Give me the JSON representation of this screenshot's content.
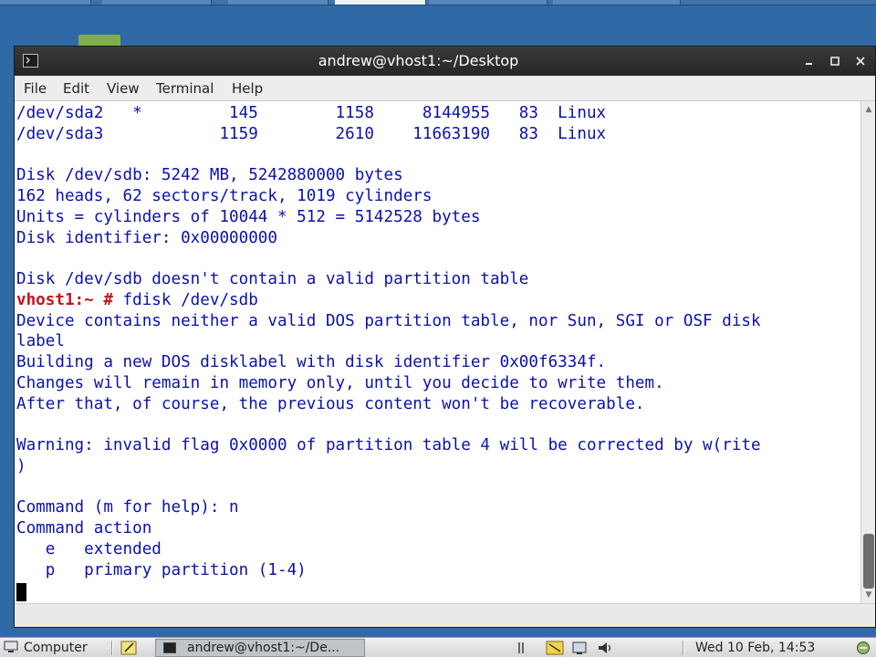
{
  "window": {
    "title": "andrew@vhost1:~/Desktop",
    "icon": "terminal-icon",
    "buttons": {
      "minimize": "minimize-icon",
      "maximize": "maximize-icon",
      "close": "close-icon"
    }
  },
  "menubar": {
    "items": [
      {
        "label": "File"
      },
      {
        "label": "Edit"
      },
      {
        "label": "View"
      },
      {
        "label": "Terminal"
      },
      {
        "label": "Help"
      }
    ]
  },
  "terminal": {
    "lines": [
      {
        "text": "/dev/sda2   *         145        1158     8144955   83  Linux"
      },
      {
        "text": "/dev/sda3            1159        2610    11663190   83  Linux"
      },
      {
        "text": ""
      },
      {
        "text": "Disk /dev/sdb: 5242 MB, 5242880000 bytes"
      },
      {
        "text": "162 heads, 62 sectors/track, 1019 cylinders"
      },
      {
        "text": "Units = cylinders of 10044 * 512 = 5142528 bytes"
      },
      {
        "text": "Disk identifier: 0x00000000"
      },
      {
        "text": ""
      },
      {
        "text": "Disk /dev/sdb doesn't contain a valid partition table"
      },
      {
        "prompt": "vhost1:~ #",
        "text": " fdisk /dev/sdb"
      },
      {
        "text": "Device contains neither a valid DOS partition table, nor Sun, SGI or OSF disk"
      },
      {
        "text": "label"
      },
      {
        "text": "Building a new DOS disklabel with disk identifier 0x00f6334f."
      },
      {
        "text": "Changes will remain in memory only, until you decide to write them."
      },
      {
        "text": "After that, of course, the previous content won't be recoverable."
      },
      {
        "text": ""
      },
      {
        "text": "Warning: invalid flag 0x0000 of partition table 4 will be corrected by w(rite"
      },
      {
        "text": ")"
      },
      {
        "text": ""
      },
      {
        "text": "Command (m for help): n"
      },
      {
        "text": "Command action"
      },
      {
        "text": "   e   extended"
      },
      {
        "text": "   p   primary partition (1-4)"
      }
    ],
    "colors": {
      "text": "#0b12a8",
      "prompt": "#c8111b",
      "background": "#ffffff"
    }
  },
  "taskbar": {
    "start_label": "Computer",
    "task_label": "andrew@vhost1:~/De...",
    "clock": "Wed 10 Feb, 14:53"
  }
}
